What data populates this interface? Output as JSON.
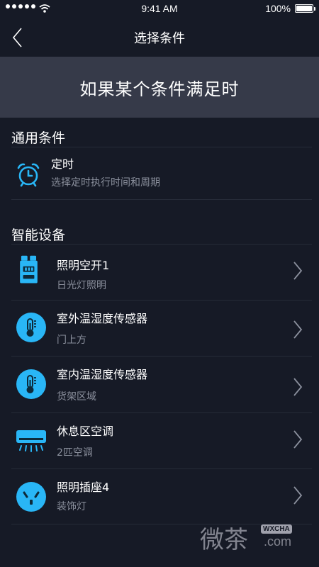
{
  "status_bar": {
    "time": "9:41 AM",
    "battery": "100%"
  },
  "nav": {
    "title": "选择条件",
    "back_icon": "chevron-left-icon"
  },
  "banner": {
    "text": "如果某个条件满足时"
  },
  "general": {
    "section_title": "通用条件",
    "timer": {
      "title": "定时",
      "subtitle": "选择定时执行时间和周期",
      "icon": "alarm-clock-icon"
    }
  },
  "smart": {
    "section_title": "智能设备",
    "devices": [
      {
        "name": "照明空开1",
        "location": "日光灯照明",
        "icon": "circuit-breaker-icon"
      },
      {
        "name": "室外温湿度传感器",
        "location": "门上方",
        "icon": "thermometer-icon"
      },
      {
        "name": "室内温湿度传感器",
        "location": "货架区域",
        "icon": "thermometer-icon"
      },
      {
        "name": "休息区空调",
        "location": "2匹空调",
        "icon": "air-conditioner-icon"
      },
      {
        "name": "照明插座4",
        "location": "装饰灯",
        "icon": "power-socket-icon"
      }
    ]
  },
  "watermark": {
    "cn": "微茶",
    "tag": "WXCHA",
    "com": ".com"
  },
  "colors": {
    "background": "#161a26",
    "banner": "#363a49",
    "accent": "#29b6f6",
    "subtext": "#8b909d"
  }
}
